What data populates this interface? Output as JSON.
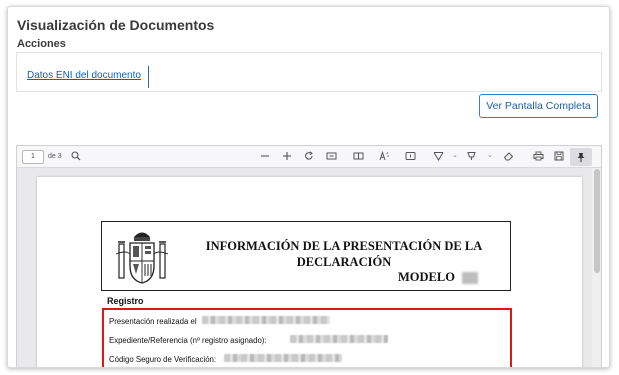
{
  "page": {
    "title": "Visualización de Documentos",
    "section": "Acciones"
  },
  "acciones": {
    "eni_link": "Datos ENI del documento"
  },
  "fullscreen_button": "Ver Pantalla Completa",
  "viewer": {
    "current_page": "1",
    "page_count_label": "de 3"
  },
  "document": {
    "title_line1": "INFORMACIÓN DE LA PRESENTACIÓN DE LA",
    "title_line2": "DECLARACIÓN",
    "model_label": "MODELO",
    "registro_label": "Registro",
    "lines": [
      "Presentación realizada el",
      "Expediente/Referencia (nº registro asignado):",
      "Código Seguro de Verificación:"
    ]
  },
  "colors": {
    "link": "#1a5fa8",
    "button_border": "#3d7dc4",
    "highlight": "#e01717"
  }
}
